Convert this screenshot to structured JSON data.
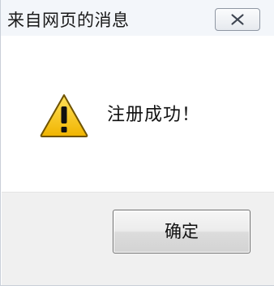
{
  "dialog": {
    "title": "来自网页的消息",
    "message": "注册成功！",
    "ok_label": "确定"
  },
  "icons": {
    "close": "close-icon",
    "warning": "warning-icon"
  },
  "colors": {
    "warning_fill": "#f5c400",
    "warning_border": "#7a5a00",
    "titlebar_bg": "#f3f6fa",
    "footer_bg": "#f0f0f0"
  }
}
